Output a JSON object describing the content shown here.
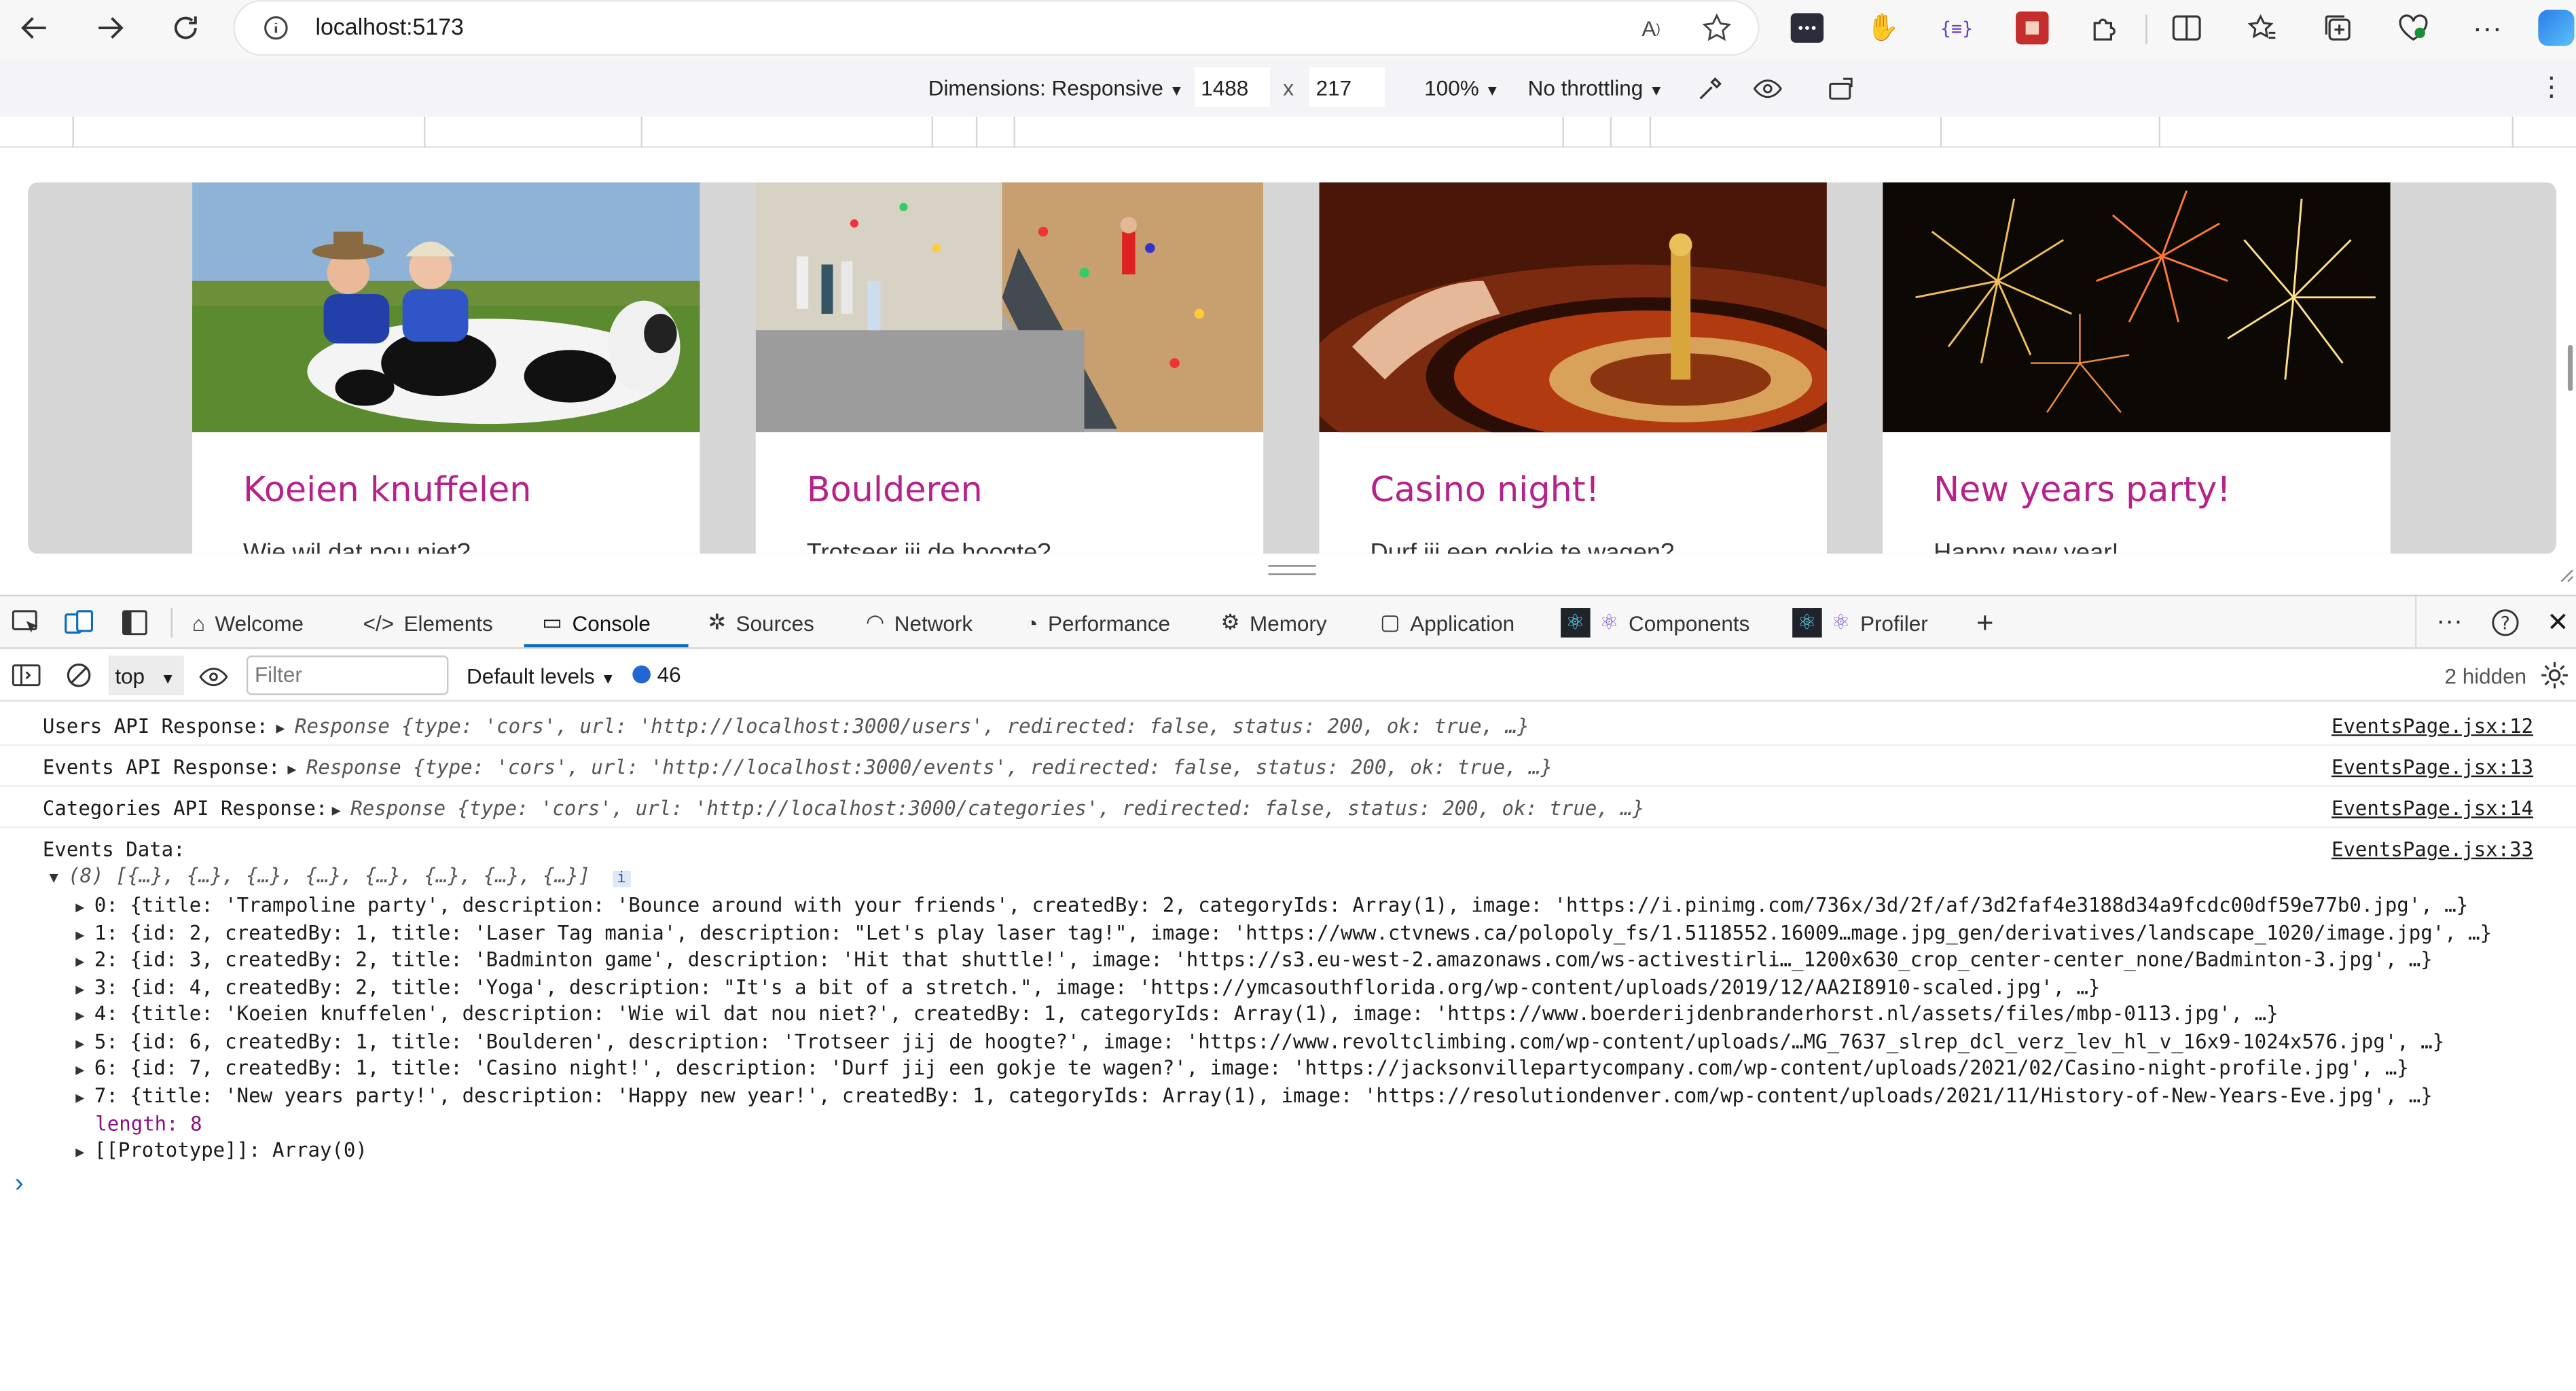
{
  "browser": {
    "url": "localhost:5173",
    "read_aloud_label": "A)",
    "device": {
      "dimensions_label": "Dimensions: Responsive",
      "width": "1488",
      "times": "x",
      "height": "217",
      "zoom": "100%",
      "throttling": "No throttling"
    }
  },
  "cards": [
    {
      "title": "Koeien knuffelen",
      "description": "Wie wil dat nou niet?"
    },
    {
      "title": "Boulderen",
      "description": "Trotseer jij de hoogte?"
    },
    {
      "title": "Casino night!",
      "description": "Durf jij een gokje te wagen?"
    },
    {
      "title": "New years party!",
      "description": "Happy new year!"
    }
  ],
  "devtools": {
    "tabs": [
      "Welcome",
      "Elements",
      "Console",
      "Sources",
      "Network",
      "Performance",
      "Memory",
      "Application",
      "Components",
      "Profiler"
    ],
    "console_toolbar": {
      "context": "top",
      "filter_placeholder": "Filter",
      "levels": "Default levels",
      "issues_count": "46",
      "hidden": "2 hidden"
    },
    "logs": [
      {
        "label": "Users API Response:",
        "body": "Response {type: 'cors', url: 'http://localhost:3000/users', redirected: false, status: 200, ok: true, …}",
        "source": "EventsPage.jsx:12"
      },
      {
        "label": "Events API Response:",
        "body": "Response {type: 'cors', url: 'http://localhost:3000/events', redirected: false, status: 200, ok: true, …}",
        "source": "EventsPage.jsx:13"
      },
      {
        "label": "Categories API Response:",
        "body": "Response {type: 'cors', url: 'http://localhost:3000/categories', redirected: false, status: 200, ok: true, …}",
        "source": "EventsPage.jsx:14"
      }
    ],
    "events_data": {
      "label": "Events Data:",
      "source": "EventsPage.jsx:33",
      "summary": "(8) [{…}, {…}, {…}, {…}, {…}, {…}, {…}, {…}]",
      "items": [
        "0: {title: 'Trampoline party', description: 'Bounce around with your friends', createdBy: 2, categoryIds: Array(1), image: 'https://i.pinimg.com/736x/3d/2f/af/3d2faf4e3188d34a9fcdc00df59e77b0.jpg', …}",
        "1: {id: 2, createdBy: 1, title: 'Laser Tag mania', description: \"Let's play laser tag!\", image: 'https://www.ctvnews.ca/polopoly_fs/1.5118552.16009…mage.jpg_gen/derivatives/landscape_1020/image.jpg', …}",
        "2: {id: 3, createdBy: 2, title: 'Badminton game', description: 'Hit that shuttle!', image: 'https://s3.eu-west-2.amazonaws.com/ws-activestirli…_1200x630_crop_center-center_none/Badminton-3.jpg', …}",
        "3: {id: 4, createdBy: 2, title: 'Yoga', description: \"It's a bit of a stretch.\", image: 'https://ymcasouthflorida.org/wp-content/uploads/2019/12/AA2I8910-scaled.jpg', …}",
        "4: {title: 'Koeien knuffelen', description: 'Wie wil dat nou niet?', createdBy: 1, categoryIds: Array(1), image: 'https://www.boerderijdenbranderhorst.nl/assets/files/mbp-0113.jpg', …}",
        "5: {id: 6, createdBy: 1, title: 'Boulderen', description: 'Trotseer jij de hoogte?', image: 'https://www.revoltclimbing.com/wp-content/uploads/…MG_7637_slrep_dcl_verz_lev_hl_v_16x9-1024x576.jpg', …}",
        "6: {id: 7, createdBy: 1, title: 'Casino night!', description: 'Durf jij een gokje te wagen?', image: 'https://jacksonvillepartycompany.com/wp-content/uploads/2021/02/Casino-night-profile.jpg', …}",
        "7: {title: 'New years party!', description: 'Happy new year!', createdBy: 1, categoryIds: Array(1), image: 'https://resolutiondenver.com/wp-content/uploads/2021/11/History-of-New-Years-Eve.jpg', …}"
      ],
      "length": "length: 8",
      "prototype": "[[Prototype]]: Array(0)"
    },
    "prompt": "›"
  }
}
